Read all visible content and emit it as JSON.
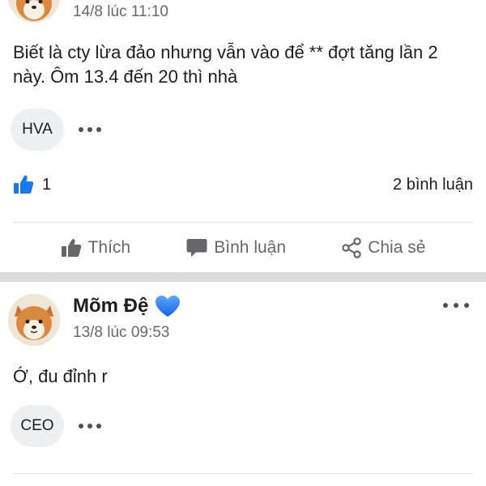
{
  "posts": [
    {
      "author": "",
      "timestamp": "14/8 lúc 11:10",
      "text": "Biết là cty lừa đảo nhưng vẫn vào để ** đợt tăng lần 2 này. Ôm 13.4 đến 20 thì nhà",
      "tag": "HVA",
      "like_count": "1",
      "comment_count": "2 bình luận",
      "actions": {
        "like": "Thích",
        "comment": "Bình luận",
        "share": "Chia sẻ"
      }
    },
    {
      "author": "Mõm Đệ",
      "author_badge_icon": "blue-heart-icon",
      "timestamp": "13/8 lúc 09:53",
      "text": "Ớ, đu đỉnh r",
      "tag": "CEO"
    }
  ],
  "colors": {
    "like_blue": "#1877f2",
    "muted_text": "#65676b",
    "chip_bg": "#eff0f2",
    "separator": "#dcdcdc"
  }
}
